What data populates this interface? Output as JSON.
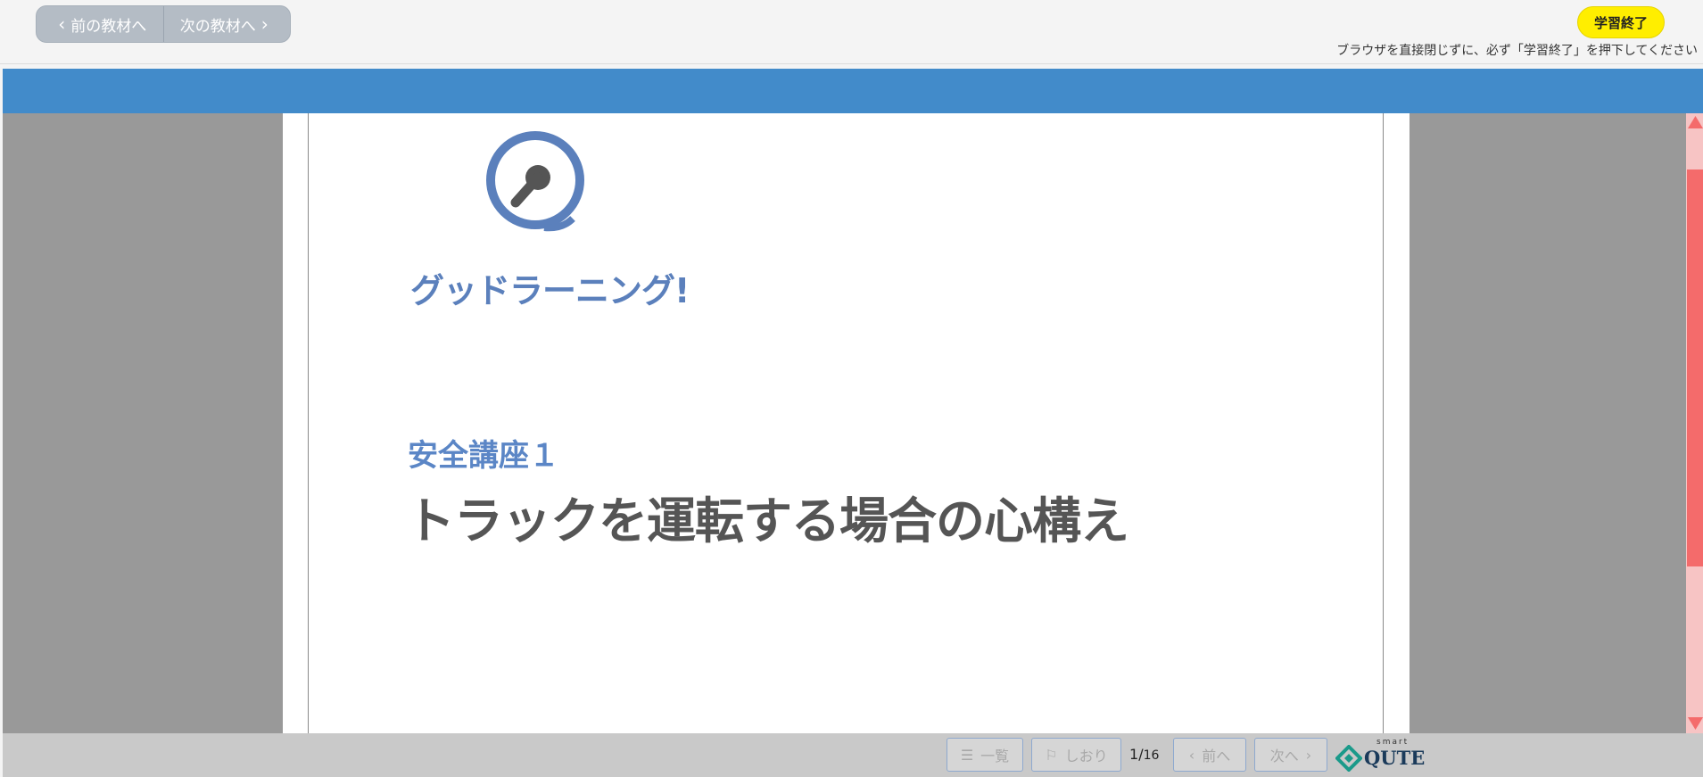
{
  "topbar": {
    "prev_label": "前の教材へ",
    "next_label": "次の教材へ",
    "finish_label": "学習終了",
    "notice": "ブラウザを直接閉じずに、必ず「学習終了」を押下してください"
  },
  "slide": {
    "logo_caption": "グッドラーニング!",
    "subtitle": "安全講座１",
    "title": "トラックを運転する場合の心構え"
  },
  "scroll": {
    "position_fraction": 0.0,
    "visible_fraction": 0.67
  },
  "footer": {
    "list_label": "一覧",
    "bookmark_label": "しおり",
    "page_current": "1",
    "page_separator": "/",
    "page_total": "16",
    "prev_label": "前へ",
    "next_label": "次へ",
    "brand_small": "smart",
    "brand_name": "QUTE"
  },
  "icons": {
    "prev": "chevron-left-icon",
    "next": "chevron-right-icon",
    "list": "list-icon",
    "bookmark": "bookmark-icon",
    "logo": "magnifier-logo-icon"
  },
  "colors": {
    "header_blue": "#428bca",
    "finish_yellow": "#ffee00",
    "scroll_thumb": "#f46b6b",
    "scroll_track": "#f7c4c4",
    "logo_blue": "#5b80bc",
    "brand_teal": "#1a9a8a"
  }
}
